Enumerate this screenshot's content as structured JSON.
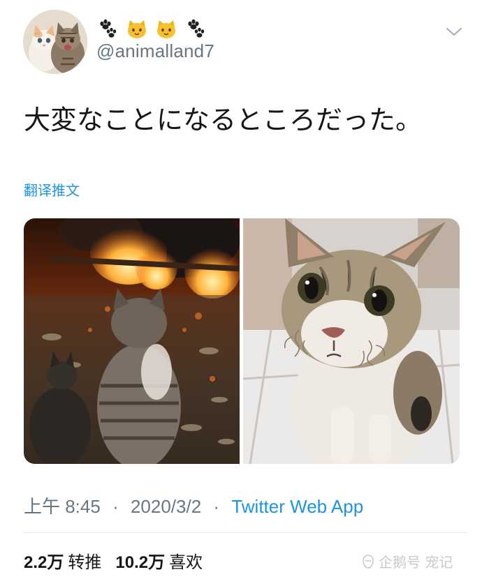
{
  "author": {
    "display_name_icons": [
      "paw-prints-icon",
      "cat-face-icon",
      "cat-face-icon",
      "paw-prints-icon"
    ],
    "handle": "@animalland7",
    "avatar": "kittens-avatar"
  },
  "tweet": {
    "text": "大変なことになるところだった。",
    "translate_label": "翻译推文",
    "images": [
      {
        "name": "cats-by-fire-photo"
      },
      {
        "name": "cat-with-singed-whiskers-photo"
      }
    ]
  },
  "meta": {
    "time": "上午 8:45",
    "separator": "·",
    "date": "2020/3/2",
    "source": "Twitter Web App"
  },
  "stats": {
    "retweets_count": "2.2万",
    "retweets_label": "转推",
    "likes_count": "10.2万",
    "likes_label": "喜欢"
  },
  "watermark": {
    "text": "企鹅号 宠记"
  },
  "colors": {
    "link": "#1b95e0",
    "secondary_text": "#657786",
    "primary_text": "#14171a",
    "divider": "#e1e8ed"
  }
}
